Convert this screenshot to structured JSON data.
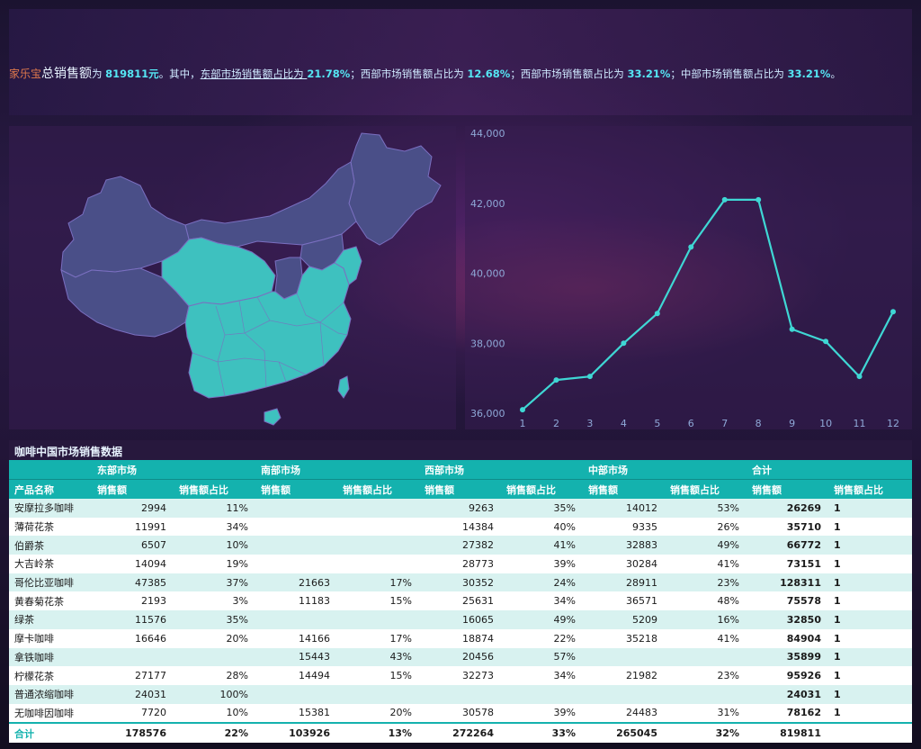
{
  "header": {
    "brand": "家乐宝",
    "big_label": "总销售额",
    "prefix": "为 ",
    "total": "819811元",
    "mid1": "。其中，",
    "east_label": "东部市场销售额占比为 ",
    "east_pct": "21.78%",
    "sep1": "；西部市场销售额占比为 ",
    "west_pct": "12.68%",
    "sep2": "；西部市场销售额占比为 ",
    "west2_pct": "33.21%",
    "sep3": "；中部市场销售额占比为 ",
    "central_pct": "33.21%",
    "end": "。"
  },
  "map": {
    "highlight_color": "#3ec1bf",
    "base_color": "#4a4f88",
    "border_color": "#7a6fc0"
  },
  "chart_data": {
    "type": "line",
    "x": [
      1,
      2,
      3,
      4,
      5,
      6,
      7,
      8,
      9,
      10,
      11,
      12
    ],
    "values": [
      36100,
      36950,
      37050,
      38000,
      38850,
      40750,
      42100,
      42100,
      38400,
      38050,
      37050,
      38900
    ],
    "ylim": [
      36000,
      44000
    ],
    "yticks": [
      "36,000",
      "38,000",
      "40,000",
      "42,000",
      "44,000"
    ],
    "ytick_values": [
      36000,
      38000,
      40000,
      42000,
      44000
    ],
    "xticks": [
      "1",
      "2",
      "3",
      "4",
      "5",
      "6",
      "7",
      "8",
      "9",
      "10",
      "11",
      "12"
    ],
    "color": "#3fd7d4",
    "grid": false
  },
  "table": {
    "title": "咖啡中国市场销售数据",
    "groups": [
      "东部市场",
      "南部市场",
      "西部市场",
      "中部市场",
      "合计"
    ],
    "col_name": "产品名称",
    "col_sales": "销售额",
    "col_pct": "销售额占比",
    "rows": [
      {
        "name": "安摩拉多咖啡",
        "e": "2994",
        "ep": "11%",
        "s": "",
        "sp": "",
        "w": "9263",
        "wp": "35%",
        "c": "14012",
        "cp": "53%",
        "t": "26269",
        "tp": "1"
      },
      {
        "name": "薄荷花茶",
        "e": "11991",
        "ep": "34%",
        "s": "",
        "sp": "",
        "w": "14384",
        "wp": "40%",
        "c": "9335",
        "cp": "26%",
        "t": "35710",
        "tp": "1"
      },
      {
        "name": "伯爵茶",
        "e": "6507",
        "ep": "10%",
        "s": "",
        "sp": "",
        "w": "27382",
        "wp": "41%",
        "c": "32883",
        "cp": "49%",
        "t": "66772",
        "tp": "1"
      },
      {
        "name": "大吉岭茶",
        "e": "14094",
        "ep": "19%",
        "s": "",
        "sp": "",
        "w": "28773",
        "wp": "39%",
        "c": "30284",
        "cp": "41%",
        "t": "73151",
        "tp": "1"
      },
      {
        "name": "哥伦比亚咖啡",
        "e": "47385",
        "ep": "37%",
        "s": "21663",
        "sp": "17%",
        "w": "30352",
        "wp": "24%",
        "c": "28911",
        "cp": "23%",
        "t": "128311",
        "tp": "1"
      },
      {
        "name": "黄春菊花茶",
        "e": "2193",
        "ep": "3%",
        "s": "11183",
        "sp": "15%",
        "w": "25631",
        "wp": "34%",
        "c": "36571",
        "cp": "48%",
        "t": "75578",
        "tp": "1"
      },
      {
        "name": "绿茶",
        "e": "11576",
        "ep": "35%",
        "s": "",
        "sp": "",
        "w": "16065",
        "wp": "49%",
        "c": "5209",
        "cp": "16%",
        "t": "32850",
        "tp": "1"
      },
      {
        "name": "摩卡咖啡",
        "e": "16646",
        "ep": "20%",
        "s": "14166",
        "sp": "17%",
        "w": "18874",
        "wp": "22%",
        "c": "35218",
        "cp": "41%",
        "t": "84904",
        "tp": "1"
      },
      {
        "name": "拿铁咖啡",
        "e": "",
        "ep": "",
        "s": "15443",
        "sp": "43%",
        "w": "20456",
        "wp": "57%",
        "c": "",
        "cp": "",
        "t": "35899",
        "tp": "1"
      },
      {
        "name": "柠檬花茶",
        "e": "27177",
        "ep": "28%",
        "s": "14494",
        "sp": "15%",
        "w": "32273",
        "wp": "34%",
        "c": "21982",
        "cp": "23%",
        "t": "95926",
        "tp": "1"
      },
      {
        "name": "普通浓缩咖啡",
        "e": "24031",
        "ep": "100%",
        "s": "",
        "sp": "",
        "w": "",
        "wp": "",
        "c": "",
        "cp": "",
        "t": "24031",
        "tp": "1"
      },
      {
        "name": "无咖啡因咖啡",
        "e": "7720",
        "ep": "10%",
        "s": "15381",
        "sp": "20%",
        "w": "30578",
        "wp": "39%",
        "c": "24483",
        "cp": "31%",
        "t": "78162",
        "tp": "1"
      }
    ],
    "total": {
      "name": "合计",
      "e": "178576",
      "ep": "22%",
      "s": "103926",
      "sp": "13%",
      "w": "272264",
      "wp": "33%",
      "c": "265045",
      "cp": "32%",
      "t": "819811",
      "tp": ""
    }
  }
}
